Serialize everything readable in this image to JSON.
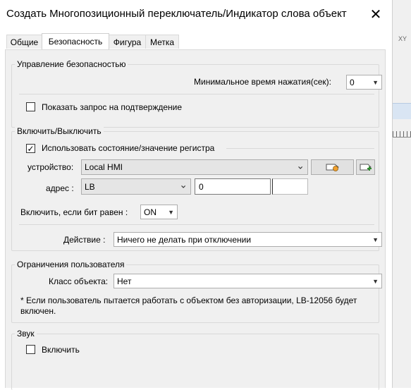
{
  "window": {
    "title": "Создать Многопозиционный переключатель/Индикатор слова объект",
    "close_glyph": "✕"
  },
  "tabs": [
    {
      "label": "Общие",
      "active": false
    },
    {
      "label": "Безопасность",
      "active": true
    },
    {
      "label": "Фигура",
      "active": false
    },
    {
      "label": "Метка",
      "active": false
    }
  ],
  "security": {
    "group_label": "Управление безопасностью",
    "min_press_label": "Минимальное время нажатия(сек):",
    "min_press_value": "0",
    "confirm_label": "Показать запрос на подтверждение",
    "confirm_checked": false
  },
  "enable": {
    "group_label": "Включить/Выключить",
    "use_register_label": "Использовать состояние/значение регистра",
    "use_register_checked": true,
    "device_label": "устройство:",
    "device_value": "Local HMI",
    "address_label": "адрес :",
    "address_type": "LB",
    "address_value": "0",
    "enable_if_label": "Включить, если бит равен :",
    "enable_if_value": "ON",
    "action_label": "Действие :",
    "action_value": "Ничего не делать при отключении"
  },
  "user": {
    "group_label": "Ограничения пользователя",
    "class_label": "Класс объекта:",
    "class_value": "Нет",
    "note": "* Если пользователь пытается работать с объектом без авторизации, LB-12056 будет включен."
  },
  "sound": {
    "group_label": "Звук",
    "enable_label": "Включить",
    "enable_checked": false
  },
  "background": {
    "partial_text": "XY"
  },
  "icons": {
    "check": "✓",
    "dropdown": "▼",
    "chevron": "⌄"
  }
}
